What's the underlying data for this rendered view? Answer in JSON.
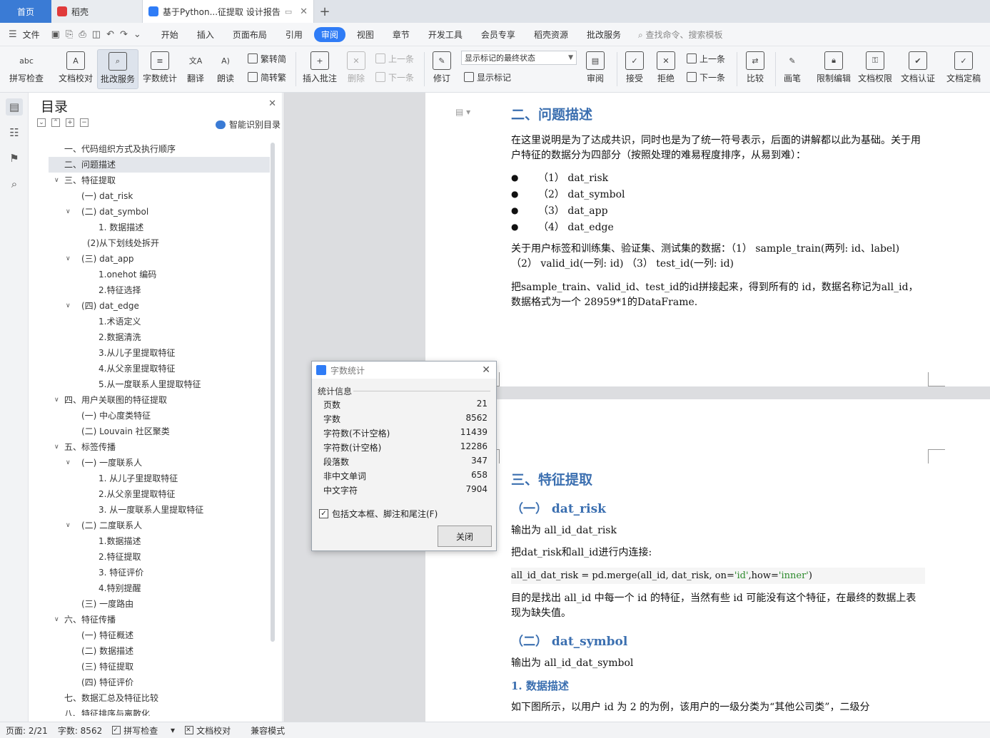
{
  "tabs": {
    "home": "首页",
    "daoke": "稻壳",
    "doc": "基于Python...征提取 设计报告",
    "add": "+"
  },
  "menu": {
    "file": "文件",
    "items": [
      "开始",
      "插入",
      "页面布局",
      "引用",
      "审阅",
      "视图",
      "章节",
      "开发工具",
      "会员专享",
      "稻壳资源",
      "批改服务"
    ],
    "active": "审阅",
    "search": "查找命令、搜索模板"
  },
  "ribbon": {
    "spell": "拼写检查",
    "proof": "文档校对",
    "batch": "批改服务",
    "wordcount": "字数统计",
    "translate": "翻译",
    "read": "朗读",
    "trad": "繁转简",
    "simp": "简转繁",
    "insert_comment": "插入批注",
    "delete": "删除",
    "prev": "上一条",
    "next": "下一条",
    "revise": "修订",
    "markup_select": "显示标记的最终状态",
    "show_markup": "显示标记",
    "review": "审阅",
    "accept": "接受",
    "reject": "拒绝",
    "prev2": "上一条",
    "next2": "下一条",
    "compare": "比较",
    "pen": "画笔",
    "restrict": "限制编辑",
    "permission": "文档权限",
    "certify": "文档认证",
    "finalize": "文档定稿"
  },
  "toc": {
    "title": "目录",
    "smart": "智能识别目录",
    "items": [
      "一、代码组织方式及执行顺序",
      "二、问题描述",
      "三、特征提取",
      "(一) dat_risk",
      "(二) dat_symbol",
      "1. 数据描述",
      "(2)从下划线处拆开",
      "(三) dat_app",
      "1.onehot 编码",
      "2.特征选择",
      "(四) dat_edge",
      "1.术语定义",
      "2.数据清洗",
      "3.从儿子里提取特征",
      "4.从父亲里提取特征",
      "5.从一度联系人里提取特征",
      "四、用户关联图的特征提取",
      "(一) 中心度类特征",
      "(二) Louvain 社区聚类",
      "五、标签传播",
      "(一) 一度联系人",
      "1. 从儿子里提取特征",
      "2.从父亲里提取特征",
      "3. 从一度联系人里提取特征",
      "(二) 二度联系人",
      "1.数据描述",
      "2.特征提取",
      "3. 特征评价",
      "4.特别提醒",
      "(三) 一度路由",
      "六、特征传播",
      "(一) 特征概述",
      "(二) 数据描述",
      "(三) 特征提取",
      "(四) 特征评价",
      "七、数据汇总及特征比较",
      "八、特征排序与离散化"
    ]
  },
  "doc": {
    "h_problem": "二、问题描述",
    "p1": "在这里说明是为了达成共识，同时也是为了统一符号表示，后面的讲解都以此为基础。关于用户特征的数据分为四部分（按照处理的难易程度排序，从易到难）：",
    "bullets": [
      "（1） dat_risk",
      "（2） dat_symbol",
      "（3） dat_app",
      "（4） dat_edge"
    ],
    "p2": "关于用户标签和训练集、验证集、测试集的数据：（1） sample_train(两列: id、label) （2） valid_id(一列: id) （3） test_id(一列: id)",
    "p3": "把sample_train、valid_id、test_id的id拼接起来，得到所有的 id，数据名称记为all_id，数据格式为一个 28959*1的DataFrame.",
    "h_feature": "三、特征提取",
    "h_risk": "（一） dat_risk",
    "p4": "输出为 all_id_dat_risk",
    "p5": "把dat_risk和all_id进行内连接:",
    "code_a": "all_id_dat_risk = pd.merge(all_id, dat_risk, on=",
    "code_s1": "'id'",
    "code_b": ",how=",
    "code_s2": "'inner'",
    "code_c": ")",
    "p6": "目的是找出 all_id 中每一个 id 的特征，当然有些 id 可能没有这个特征，在最终的数据上表现为缺失值。",
    "h_symbol": "（二） dat_symbol",
    "p7": "输出为 all_id_dat_symbol",
    "h_desc": "1. 数据描述",
    "p8": "如下图所示，以用户 id 为 2 的为例，该用户的一级分类为“其他公司类”，二级分"
  },
  "dialog": {
    "title": "字数统计",
    "group": "统计信息",
    "rows": [
      {
        "k": "页数",
        "v": "21"
      },
      {
        "k": "字数",
        "v": "8562"
      },
      {
        "k": "字符数(不计空格)",
        "v": "11439"
      },
      {
        "k": "字符数(计空格)",
        "v": "12286"
      },
      {
        "k": "段落数",
        "v": "347"
      },
      {
        "k": "非中文单词",
        "v": "658"
      },
      {
        "k": "中文字符",
        "v": "7904"
      }
    ],
    "checkbox": "包括文本框、脚注和尾注(F)",
    "close": "关闭"
  },
  "status": {
    "page": "页面: 2/21",
    "words": "字数: 8562",
    "spell": "拼写检查",
    "proof": "文档校对",
    "compat": "兼容模式"
  }
}
